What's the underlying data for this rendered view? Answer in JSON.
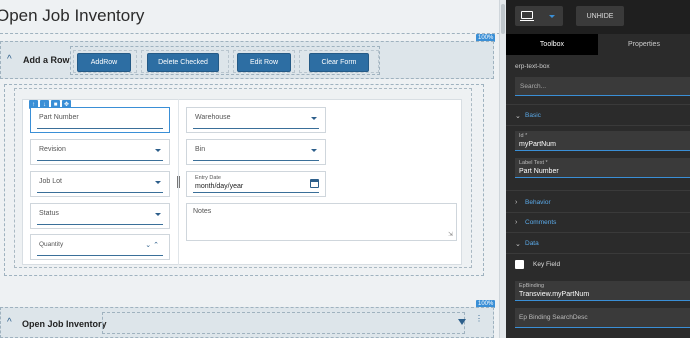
{
  "page": {
    "title": "Open Job Inventory",
    "zoom_badge": "100%"
  },
  "add_panel": {
    "title": "Add a Row",
    "buttons": [
      "AddRow",
      "Delete Checked",
      "Edit Row",
      "Clear Form"
    ]
  },
  "form": {
    "left": [
      {
        "label": "Part Number",
        "type": "text"
      },
      {
        "label": "Revision",
        "type": "dropdown"
      },
      {
        "label": "Job Lot",
        "type": "dropdown"
      },
      {
        "label": "Status",
        "type": "dropdown"
      },
      {
        "label": "Quantity",
        "type": "number"
      }
    ],
    "right": [
      {
        "label": "Warehouse",
        "type": "dropdown"
      },
      {
        "label": "Bin",
        "type": "dropdown"
      },
      {
        "label": "Entry Date",
        "value": "month/day/year",
        "type": "date"
      }
    ],
    "notes_label": "Notes",
    "toolbar_icons": [
      "arrow-up-icon",
      "arrow-down-icon",
      "delete-icon",
      "move-icon"
    ]
  },
  "jobs_panel": {
    "title": "Open Job Inventory"
  },
  "props_panel": {
    "unhide_label": "UNHIDE",
    "tabs": [
      "Toolbox",
      "Properties"
    ],
    "component_name": "erp-text-box",
    "search_placeholder": "Search...",
    "sections": {
      "basic": "Basic",
      "behavior": "Behavior",
      "comments": "Comments",
      "data": "Data"
    },
    "fields": {
      "id_label": "Id *",
      "id_value": "myPartNum",
      "label_text_label": "Label Text *",
      "label_text_value": "Part Number",
      "key_field_label": "Key Field",
      "ep_binding_label": "EpBinding",
      "ep_binding_value": "Transview.myPartNum",
      "ep_binding_search_placeholder": "Ep Binding SearchDesc"
    }
  }
}
